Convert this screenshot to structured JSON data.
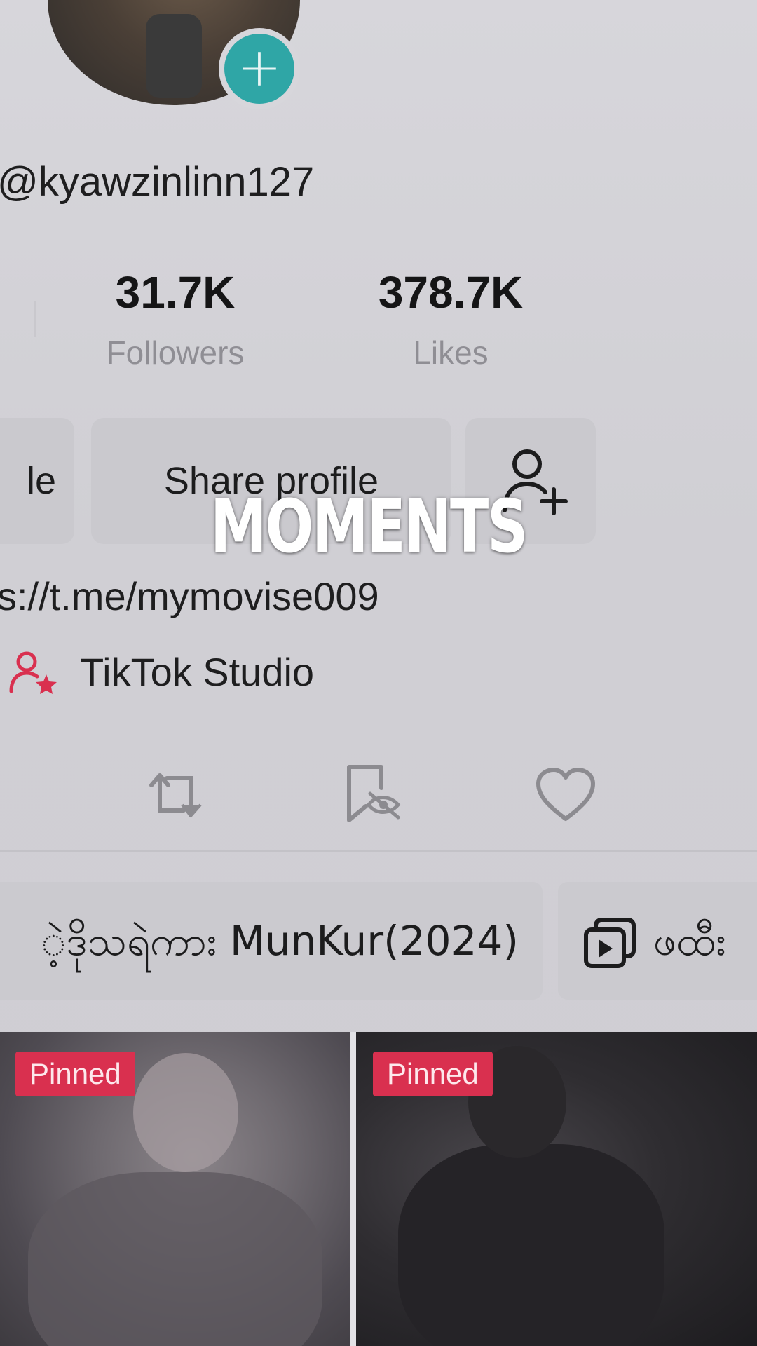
{
  "profile": {
    "username": "@kyawzinlinn127",
    "add_icon_glyph": "+"
  },
  "stats": {
    "followers": {
      "value": "31.7K",
      "label": "Followers"
    },
    "likes": {
      "value": "378.7K",
      "label": "Likes"
    }
  },
  "actions": {
    "edit_label_partial": "le",
    "share_label": "Share profile",
    "add_friend_icon": "person-plus-icon"
  },
  "overlay": {
    "caption": "MOMENTS"
  },
  "bio": {
    "link": "s://t.me/mymovise009",
    "studio_label": "TikTok Studio",
    "studio_icon_color": "#d9304f"
  },
  "tabs": [
    {
      "icon": "grid-icon"
    },
    {
      "icon": "repost-icon"
    },
    {
      "icon": "private-bookmark-icon"
    },
    {
      "icon": "heart-icon"
    }
  ],
  "playlists": [
    {
      "title": "ဲ့ဒိုသရဲကား MunKur(2024)"
    },
    {
      "title": "ဖထီး",
      "icon": "playlist-icon"
    }
  ],
  "videos": [
    {
      "badge": "Pinned"
    },
    {
      "badge": "Pinned"
    }
  ],
  "colors": {
    "accent_teal": "#2fa6a6",
    "pinned_red": "#d9304f"
  }
}
